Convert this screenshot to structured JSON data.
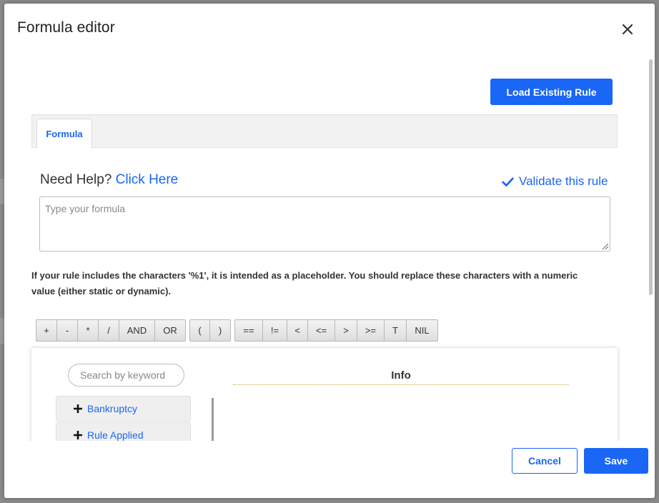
{
  "dialog": {
    "title": "Formula editor",
    "close_icon": "close-icon"
  },
  "toolbar": {
    "load_label": "Load Existing Rule"
  },
  "tabs": [
    {
      "label": "Formula",
      "active": true
    }
  ],
  "help": {
    "prefix": "Need Help? ",
    "link": "Click Here",
    "validate_label": "Validate this rule",
    "validate_icon": "checkmark-icon"
  },
  "formula_input": {
    "value": "",
    "placeholder": "Type your formula"
  },
  "note": "If your rule includes the characters '%1', it is intended as a placeholder. You should replace these characters with a numeric value (either static or dynamic).",
  "operators": {
    "arith": [
      "+",
      "-",
      "*",
      "/",
      "AND",
      "OR"
    ],
    "parens": [
      "(",
      ")"
    ],
    "compare": [
      "==",
      "!=",
      "<",
      "<=",
      ">",
      ">=",
      "T",
      "NIL"
    ]
  },
  "search": {
    "value": "",
    "placeholder": "Search by keyword"
  },
  "categories": [
    {
      "label": "Bankruptcy",
      "icon": "plus-icon"
    },
    {
      "label": "Rule Applied",
      "icon": "plus-icon"
    }
  ],
  "info": {
    "title": "Info"
  },
  "footer": {
    "cancel_label": "Cancel",
    "save_label": "Save"
  },
  "colors": {
    "accent": "#1a66f5",
    "backdrop": "#8a8a8a"
  }
}
